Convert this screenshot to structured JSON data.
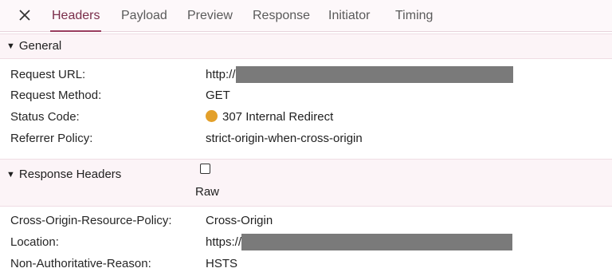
{
  "tabs": {
    "close_icon": "close-icon",
    "items": [
      "Headers",
      "Payload",
      "Preview",
      "Response",
      "Initiator",
      "Timing"
    ],
    "active": "Headers"
  },
  "general": {
    "title": "General",
    "rows": [
      {
        "key": "Request URL:",
        "value": "http://"
      },
      {
        "key": "Request Method:",
        "value": "GET"
      },
      {
        "key": "Status Code:",
        "value": "307 Internal Redirect"
      },
      {
        "key": "Referrer Policy:",
        "value": "strict-origin-when-cross-origin"
      }
    ]
  },
  "response_headers": {
    "title": "Response Headers",
    "raw_label": "Raw",
    "raw_checked": false,
    "rows": [
      {
        "key": "Cross-Origin-Resource-Policy:",
        "value": "Cross-Origin"
      },
      {
        "key": "Location:",
        "value": "https://"
      },
      {
        "key": "Non-Authoritative-Reason:",
        "value": "HSTS"
      }
    ]
  },
  "colors": {
    "active_tab": "#7a2e4a",
    "status_dot": "#e3a02a",
    "redaction": "#7a7a7a"
  }
}
